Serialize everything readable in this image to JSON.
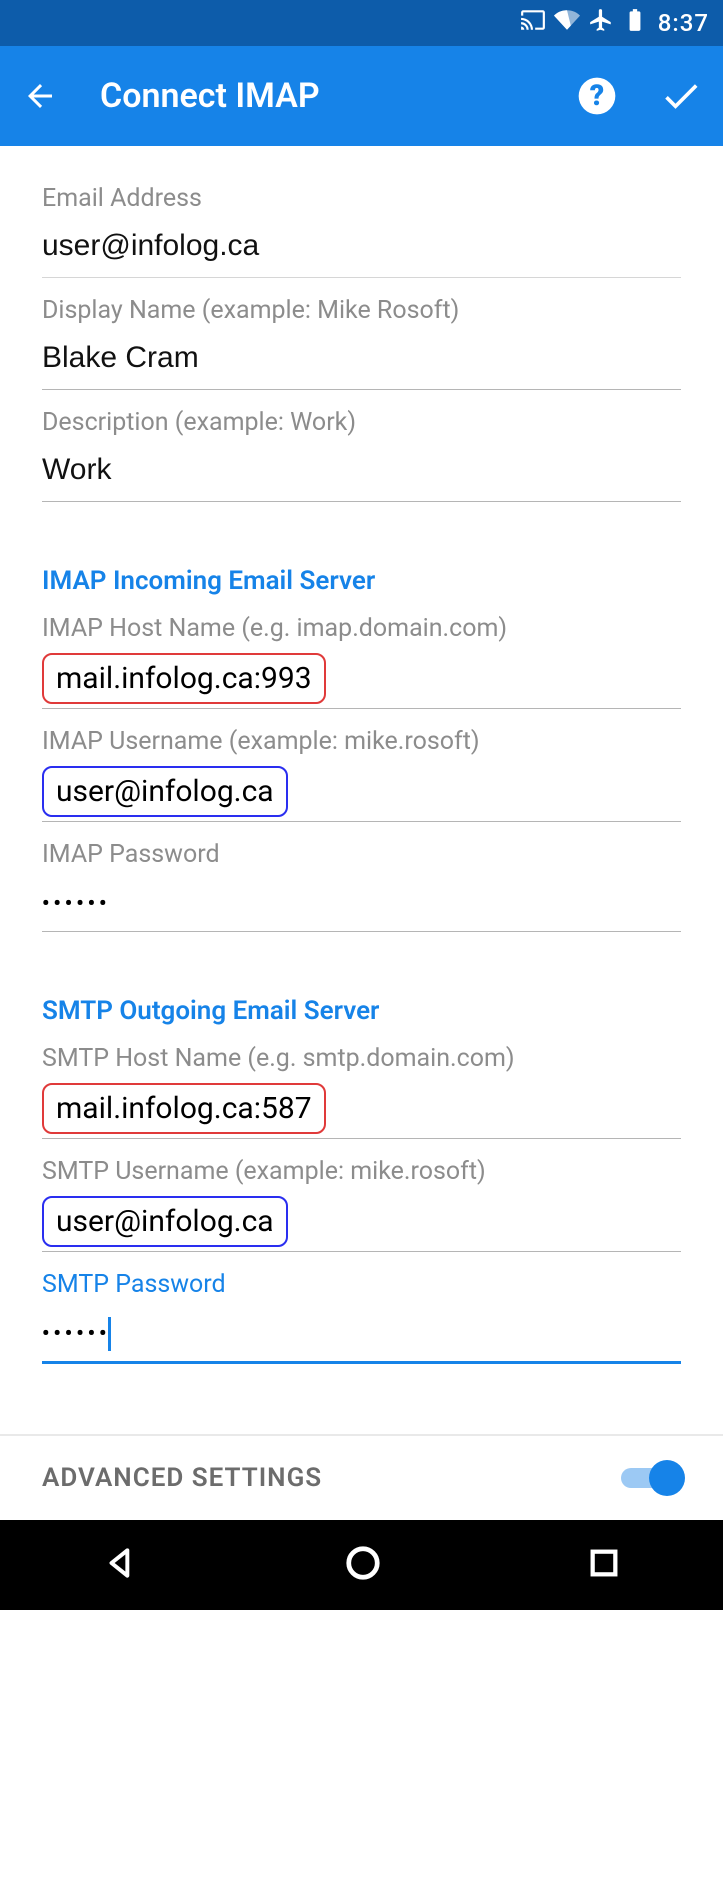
{
  "status": {
    "time": "8:37"
  },
  "appbar": {
    "title": "Connect IMAP"
  },
  "fields": {
    "email_label": "Email Address",
    "email_value": "user@infolog.ca",
    "display_label": "Display Name (example: Mike Rosoft)",
    "display_value": "Blake Cram",
    "desc_label": "Description (example: Work)",
    "desc_value": "Work"
  },
  "imap": {
    "section": "IMAP Incoming Email Server",
    "host_label": "IMAP Host Name (e.g. imap.domain.com)",
    "host_value": "mail.infolog.ca:993",
    "user_label": "IMAP Username (example: mike.rosoft)",
    "user_value": "user@infolog.ca",
    "pass_label": "IMAP Password",
    "pass_value": "••••••"
  },
  "smtp": {
    "section": "SMTP Outgoing Email Server",
    "host_label": "SMTP Host Name (e.g. smtp.domain.com)",
    "host_value": "mail.infolog.ca:587",
    "user_label": "SMTP Username (example: mike.rosoft)",
    "user_value": "user@infolog.ca",
    "pass_label": "SMTP Password",
    "pass_value": "••••••"
  },
  "advanced": {
    "label": "ADVANCED SETTINGS"
  }
}
